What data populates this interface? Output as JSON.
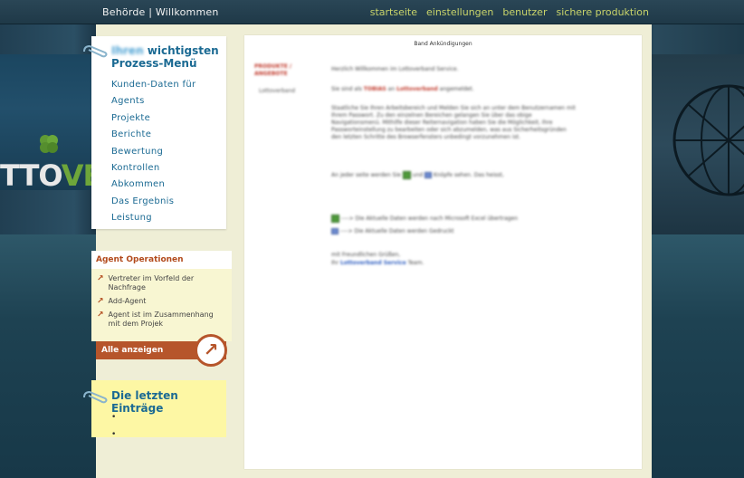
{
  "header": {
    "brand_left": "Behörde",
    "brand_sep": "|",
    "brand_right": "Willkommen",
    "nav": [
      "startseite",
      "einstellungen",
      "benutzer",
      "sichere produktion"
    ]
  },
  "banner": {
    "text_main": "TTO",
    "text_accent": "VE"
  },
  "menu": {
    "title_blurred": "Ihren",
    "title_rest": "wichtigsten",
    "title_line2": "Prozess-Menü",
    "items": [
      "Kunden-Daten für",
      "Agents",
      "Projekte",
      "Berichte",
      "Bewertung",
      "Kontrollen",
      "Abkommen",
      "Das Ergebnis",
      "Leistung"
    ]
  },
  "operations": {
    "title": "Agent Operationen",
    "items": [
      "Vertreter im Vorfeld der Nachfrage",
      "Add-Agent",
      "Agent ist im Zusammenhang mit dem Projek"
    ],
    "show_all": "Alle anzeigen",
    "arrow_glyph": "↗"
  },
  "recent": {
    "title": "Die letzten Einträge",
    "items": [
      "",
      ""
    ]
  },
  "content": {
    "header": "Band Ankündigungen",
    "label_red_1": "PRODUKTE /",
    "label_red_2": "ANGEBOTE",
    "label_grey": "Lottoverband",
    "p1": "Herzlich Willkommen im Lottoverband Service.",
    "p2a": "Sie sind als",
    "p2red": "TOBIAS",
    "p2b": "an",
    "p2red2": "Lottoverband",
    "p2c": "angemeldet.",
    "p3": "Staatliche Sie Ihren Arbeitsbereich und Melden Sie sich an unter dem Benutzernamen mit Ihrem Passwort. Zu den einzelnen Bereichen gelangen Sie über das obige Navigationsmenü. Mithilfe dieser Reiternavigation haben Sie die Möglichkeit, Ihre Passworteinstellung zu bearbeiten oder sich abzumelden, was aus Sicherheitsgründen den letzten Schritte des Browserfensters unbedingt vorzunehmen ist.",
    "p4a": "An jeder seite werden Sie",
    "p4b": "und",
    "p4c": "Knöpfe sehen. Das heisst,",
    "p5": "----> Die Aktuelle Daten werden nach Microsoft Excel übertragen",
    "p6": "----> Die Aktuelle Daten werden Gedruckt",
    "p7": "mit Freundlichen Grüßen,",
    "p8a": "Ihr",
    "p8blue": "Lottoverband Service",
    "p8b": "Team."
  }
}
